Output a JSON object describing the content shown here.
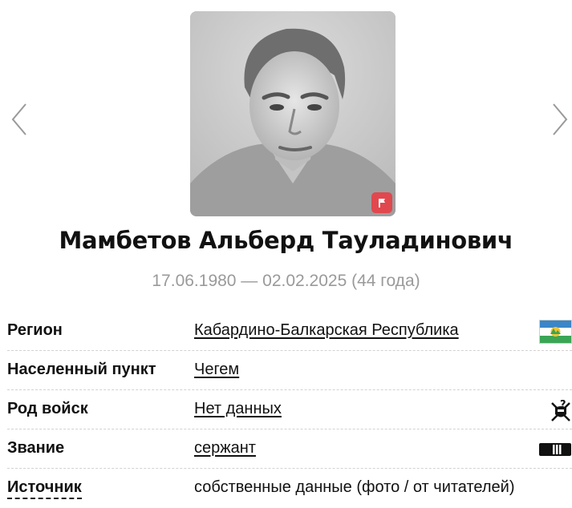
{
  "person": {
    "name": "Мамбетов Альберд Тауладинович",
    "dates": "17.06.1980 — 02.02.2025 (44 года)"
  },
  "icons": {
    "prev": "chevron-left-icon",
    "next": "chevron-right-icon",
    "report": "flag-icon",
    "region": "kbr-flag-icon",
    "branch": "unknown-branch-icon",
    "rank": "rank-insignia-icon"
  },
  "colors": {
    "report_badge": "#e0484e",
    "dates_text": "#9a9a9a",
    "flag_blue": "#3a86c8",
    "flag_white": "#ffffff",
    "flag_green": "#3aa655"
  },
  "info": {
    "rows": [
      {
        "label": "Регион",
        "value": "Кабардино-Балкарская Республика"
      },
      {
        "label": "Населенный пункт",
        "value": "Чегем"
      },
      {
        "label": "Род войск",
        "value": "Нет данных"
      },
      {
        "label": "Звание",
        "value": "сержант"
      },
      {
        "label": "Источник",
        "value": "собственные данные (фото / от читателей)"
      }
    ]
  }
}
